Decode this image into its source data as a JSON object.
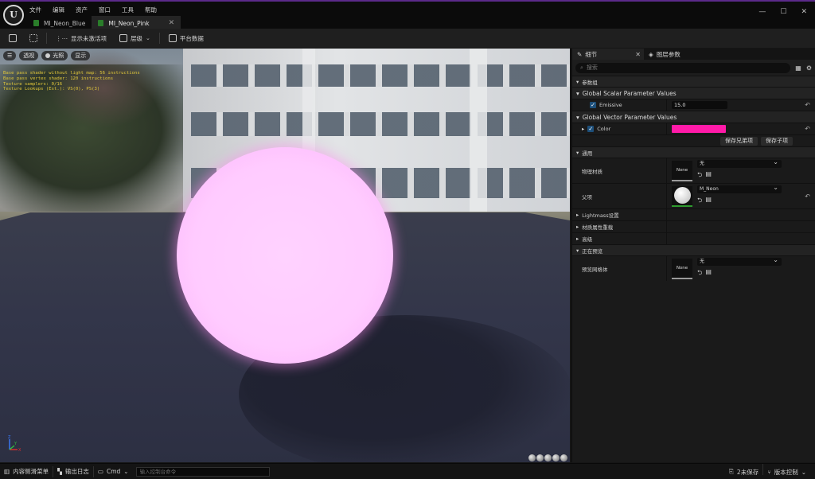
{
  "app": {
    "menu": [
      "文件",
      "编辑",
      "资产",
      "窗口",
      "工具",
      "帮助"
    ],
    "tabs": [
      {
        "label": "MI_Neon_Blue",
        "active": false
      },
      {
        "label": "MI_Neon_Pink",
        "active": true
      }
    ],
    "window_controls": [
      "—",
      "☐",
      "✕"
    ]
  },
  "toolbar": {
    "show_inactive": "显示未激活项",
    "hierarchy": "层级",
    "platform_data": "平台数据"
  },
  "viewport": {
    "buttons": {
      "menu": "☰",
      "perspective": "透视",
      "lit": "光照",
      "show": "显示"
    },
    "stats": [
      "Base pass shader without light map: 56 instructions",
      "Base pass vertex shader: 120 instructions",
      "Texture samplers: 0/16",
      "Texture Lookups (Est.): VS(0), PS(3)"
    ],
    "axis": {
      "z": "Z",
      "x": "X",
      "y": "Y"
    },
    "sphere_color": "#ffccff"
  },
  "panel": {
    "tabs": {
      "details": "细节",
      "layer_params": "图层参数"
    },
    "search_placeholder": "搜索",
    "sections": {
      "param_group": "参数组",
      "global_scalar": "Global Scalar Parameter Values",
      "global_vector": "Global Vector Parameter Values",
      "general": "通用",
      "lightmass": "Lightmass设置",
      "material_property_overrides": "材质属性重载",
      "advanced": "高级",
      "previewing": "正在预览"
    },
    "emissive": {
      "label": "Emissive",
      "value": "15.0"
    },
    "color": {
      "label": "Color",
      "swatch": "#ff1aa8"
    },
    "buttons": {
      "save_sibling": "保存兄弟项",
      "save_child": "保存子项"
    },
    "phys_material": {
      "label": "物理材质",
      "thumb": "None",
      "value": "无"
    },
    "parent": {
      "label": "父项",
      "value": "M_Neon"
    },
    "preview_mesh": {
      "label": "预览网格体",
      "thumb": "None",
      "value": "无"
    }
  },
  "statusbar": {
    "content_drawer": "内容侧滑菜单",
    "output_log": "输出日志",
    "cmd": "Cmd",
    "cmd_placeholder": "输入控制台命令",
    "unsaved": "2未保存",
    "source_control": "版本控制"
  }
}
